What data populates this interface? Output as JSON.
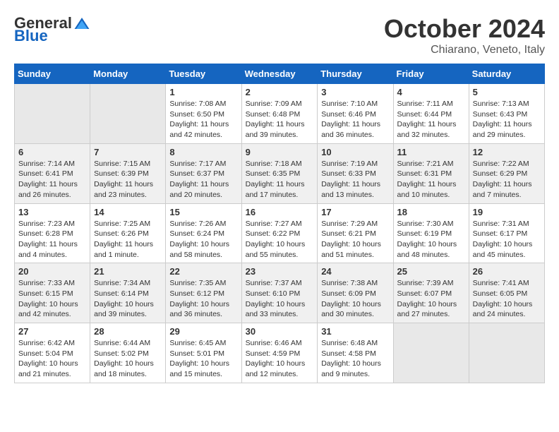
{
  "logo": {
    "general": "General",
    "blue": "Blue"
  },
  "title": "October 2024",
  "location": "Chiarano, Veneto, Italy",
  "headers": [
    "Sunday",
    "Monday",
    "Tuesday",
    "Wednesday",
    "Thursday",
    "Friday",
    "Saturday"
  ],
  "weeks": [
    [
      {
        "day": "",
        "info": ""
      },
      {
        "day": "",
        "info": ""
      },
      {
        "day": "1",
        "info": "Sunrise: 7:08 AM\nSunset: 6:50 PM\nDaylight: 11 hours\nand 42 minutes."
      },
      {
        "day": "2",
        "info": "Sunrise: 7:09 AM\nSunset: 6:48 PM\nDaylight: 11 hours\nand 39 minutes."
      },
      {
        "day": "3",
        "info": "Sunrise: 7:10 AM\nSunset: 6:46 PM\nDaylight: 11 hours\nand 36 minutes."
      },
      {
        "day": "4",
        "info": "Sunrise: 7:11 AM\nSunset: 6:44 PM\nDaylight: 11 hours\nand 32 minutes."
      },
      {
        "day": "5",
        "info": "Sunrise: 7:13 AM\nSunset: 6:43 PM\nDaylight: 11 hours\nand 29 minutes."
      }
    ],
    [
      {
        "day": "6",
        "info": "Sunrise: 7:14 AM\nSunset: 6:41 PM\nDaylight: 11 hours\nand 26 minutes."
      },
      {
        "day": "7",
        "info": "Sunrise: 7:15 AM\nSunset: 6:39 PM\nDaylight: 11 hours\nand 23 minutes."
      },
      {
        "day": "8",
        "info": "Sunrise: 7:17 AM\nSunset: 6:37 PM\nDaylight: 11 hours\nand 20 minutes."
      },
      {
        "day": "9",
        "info": "Sunrise: 7:18 AM\nSunset: 6:35 PM\nDaylight: 11 hours\nand 17 minutes."
      },
      {
        "day": "10",
        "info": "Sunrise: 7:19 AM\nSunset: 6:33 PM\nDaylight: 11 hours\nand 13 minutes."
      },
      {
        "day": "11",
        "info": "Sunrise: 7:21 AM\nSunset: 6:31 PM\nDaylight: 11 hours\nand 10 minutes."
      },
      {
        "day": "12",
        "info": "Sunrise: 7:22 AM\nSunset: 6:29 PM\nDaylight: 11 hours\nand 7 minutes."
      }
    ],
    [
      {
        "day": "13",
        "info": "Sunrise: 7:23 AM\nSunset: 6:28 PM\nDaylight: 11 hours\nand 4 minutes."
      },
      {
        "day": "14",
        "info": "Sunrise: 7:25 AM\nSunset: 6:26 PM\nDaylight: 11 hours\nand 1 minute."
      },
      {
        "day": "15",
        "info": "Sunrise: 7:26 AM\nSunset: 6:24 PM\nDaylight: 10 hours\nand 58 minutes."
      },
      {
        "day": "16",
        "info": "Sunrise: 7:27 AM\nSunset: 6:22 PM\nDaylight: 10 hours\nand 55 minutes."
      },
      {
        "day": "17",
        "info": "Sunrise: 7:29 AM\nSunset: 6:21 PM\nDaylight: 10 hours\nand 51 minutes."
      },
      {
        "day": "18",
        "info": "Sunrise: 7:30 AM\nSunset: 6:19 PM\nDaylight: 10 hours\nand 48 minutes."
      },
      {
        "day": "19",
        "info": "Sunrise: 7:31 AM\nSunset: 6:17 PM\nDaylight: 10 hours\nand 45 minutes."
      }
    ],
    [
      {
        "day": "20",
        "info": "Sunrise: 7:33 AM\nSunset: 6:15 PM\nDaylight: 10 hours\nand 42 minutes."
      },
      {
        "day": "21",
        "info": "Sunrise: 7:34 AM\nSunset: 6:14 PM\nDaylight: 10 hours\nand 39 minutes."
      },
      {
        "day": "22",
        "info": "Sunrise: 7:35 AM\nSunset: 6:12 PM\nDaylight: 10 hours\nand 36 minutes."
      },
      {
        "day": "23",
        "info": "Sunrise: 7:37 AM\nSunset: 6:10 PM\nDaylight: 10 hours\nand 33 minutes."
      },
      {
        "day": "24",
        "info": "Sunrise: 7:38 AM\nSunset: 6:09 PM\nDaylight: 10 hours\nand 30 minutes."
      },
      {
        "day": "25",
        "info": "Sunrise: 7:39 AM\nSunset: 6:07 PM\nDaylight: 10 hours\nand 27 minutes."
      },
      {
        "day": "26",
        "info": "Sunrise: 7:41 AM\nSunset: 6:05 PM\nDaylight: 10 hours\nand 24 minutes."
      }
    ],
    [
      {
        "day": "27",
        "info": "Sunrise: 6:42 AM\nSunset: 5:04 PM\nDaylight: 10 hours\nand 21 minutes."
      },
      {
        "day": "28",
        "info": "Sunrise: 6:44 AM\nSunset: 5:02 PM\nDaylight: 10 hours\nand 18 minutes."
      },
      {
        "day": "29",
        "info": "Sunrise: 6:45 AM\nSunset: 5:01 PM\nDaylight: 10 hours\nand 15 minutes."
      },
      {
        "day": "30",
        "info": "Sunrise: 6:46 AM\nSunset: 4:59 PM\nDaylight: 10 hours\nand 12 minutes."
      },
      {
        "day": "31",
        "info": "Sunrise: 6:48 AM\nSunset: 4:58 PM\nDaylight: 10 hours\nand 9 minutes."
      },
      {
        "day": "",
        "info": ""
      },
      {
        "day": "",
        "info": ""
      }
    ]
  ]
}
